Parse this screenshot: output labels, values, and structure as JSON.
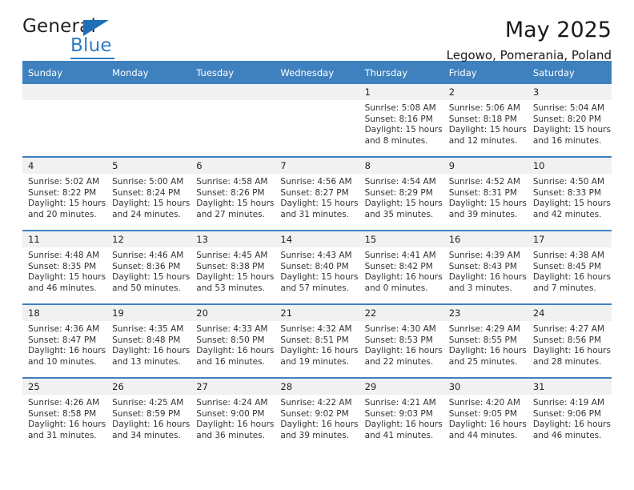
{
  "logo": {
    "word_top": "General",
    "word_bottom": "Blue"
  },
  "header": {
    "title": "May 2025",
    "subtitle": "Legowo, Pomerania, Poland"
  },
  "weekday_headers": [
    "Sunday",
    "Monday",
    "Tuesday",
    "Wednesday",
    "Thursday",
    "Friday",
    "Saturday"
  ],
  "colors": {
    "header_blue": "#3f81bf",
    "logo_blue": "#2b7cc4",
    "daynum_band": "#f1f1f1",
    "text": "#222222"
  },
  "weeks": [
    [
      {
        "day": "",
        "lines": []
      },
      {
        "day": "",
        "lines": []
      },
      {
        "day": "",
        "lines": []
      },
      {
        "day": "",
        "lines": []
      },
      {
        "day": "1",
        "lines": [
          "Sunrise: 5:08 AM",
          "Sunset: 8:16 PM",
          "Daylight: 15 hours",
          "and 8 minutes."
        ]
      },
      {
        "day": "2",
        "lines": [
          "Sunrise: 5:06 AM",
          "Sunset: 8:18 PM",
          "Daylight: 15 hours",
          "and 12 minutes."
        ]
      },
      {
        "day": "3",
        "lines": [
          "Sunrise: 5:04 AM",
          "Sunset: 8:20 PM",
          "Daylight: 15 hours",
          "and 16 minutes."
        ]
      }
    ],
    [
      {
        "day": "4",
        "lines": [
          "Sunrise: 5:02 AM",
          "Sunset: 8:22 PM",
          "Daylight: 15 hours",
          "and 20 minutes."
        ]
      },
      {
        "day": "5",
        "lines": [
          "Sunrise: 5:00 AM",
          "Sunset: 8:24 PM",
          "Daylight: 15 hours",
          "and 24 minutes."
        ]
      },
      {
        "day": "6",
        "lines": [
          "Sunrise: 4:58 AM",
          "Sunset: 8:26 PM",
          "Daylight: 15 hours",
          "and 27 minutes."
        ]
      },
      {
        "day": "7",
        "lines": [
          "Sunrise: 4:56 AM",
          "Sunset: 8:27 PM",
          "Daylight: 15 hours",
          "and 31 minutes."
        ]
      },
      {
        "day": "8",
        "lines": [
          "Sunrise: 4:54 AM",
          "Sunset: 8:29 PM",
          "Daylight: 15 hours",
          "and 35 minutes."
        ]
      },
      {
        "day": "9",
        "lines": [
          "Sunrise: 4:52 AM",
          "Sunset: 8:31 PM",
          "Daylight: 15 hours",
          "and 39 minutes."
        ]
      },
      {
        "day": "10",
        "lines": [
          "Sunrise: 4:50 AM",
          "Sunset: 8:33 PM",
          "Daylight: 15 hours",
          "and 42 minutes."
        ]
      }
    ],
    [
      {
        "day": "11",
        "lines": [
          "Sunrise: 4:48 AM",
          "Sunset: 8:35 PM",
          "Daylight: 15 hours",
          "and 46 minutes."
        ]
      },
      {
        "day": "12",
        "lines": [
          "Sunrise: 4:46 AM",
          "Sunset: 8:36 PM",
          "Daylight: 15 hours",
          "and 50 minutes."
        ]
      },
      {
        "day": "13",
        "lines": [
          "Sunrise: 4:45 AM",
          "Sunset: 8:38 PM",
          "Daylight: 15 hours",
          "and 53 minutes."
        ]
      },
      {
        "day": "14",
        "lines": [
          "Sunrise: 4:43 AM",
          "Sunset: 8:40 PM",
          "Daylight: 15 hours",
          "and 57 minutes."
        ]
      },
      {
        "day": "15",
        "lines": [
          "Sunrise: 4:41 AM",
          "Sunset: 8:42 PM",
          "Daylight: 16 hours",
          "and 0 minutes."
        ]
      },
      {
        "day": "16",
        "lines": [
          "Sunrise: 4:39 AM",
          "Sunset: 8:43 PM",
          "Daylight: 16 hours",
          "and 3 minutes."
        ]
      },
      {
        "day": "17",
        "lines": [
          "Sunrise: 4:38 AM",
          "Sunset: 8:45 PM",
          "Daylight: 16 hours",
          "and 7 minutes."
        ]
      }
    ],
    [
      {
        "day": "18",
        "lines": [
          "Sunrise: 4:36 AM",
          "Sunset: 8:47 PM",
          "Daylight: 16 hours",
          "and 10 minutes."
        ]
      },
      {
        "day": "19",
        "lines": [
          "Sunrise: 4:35 AM",
          "Sunset: 8:48 PM",
          "Daylight: 16 hours",
          "and 13 minutes."
        ]
      },
      {
        "day": "20",
        "lines": [
          "Sunrise: 4:33 AM",
          "Sunset: 8:50 PM",
          "Daylight: 16 hours",
          "and 16 minutes."
        ]
      },
      {
        "day": "21",
        "lines": [
          "Sunrise: 4:32 AM",
          "Sunset: 8:51 PM",
          "Daylight: 16 hours",
          "and 19 minutes."
        ]
      },
      {
        "day": "22",
        "lines": [
          "Sunrise: 4:30 AM",
          "Sunset: 8:53 PM",
          "Daylight: 16 hours",
          "and 22 minutes."
        ]
      },
      {
        "day": "23",
        "lines": [
          "Sunrise: 4:29 AM",
          "Sunset: 8:55 PM",
          "Daylight: 16 hours",
          "and 25 minutes."
        ]
      },
      {
        "day": "24",
        "lines": [
          "Sunrise: 4:27 AM",
          "Sunset: 8:56 PM",
          "Daylight: 16 hours",
          "and 28 minutes."
        ]
      }
    ],
    [
      {
        "day": "25",
        "lines": [
          "Sunrise: 4:26 AM",
          "Sunset: 8:58 PM",
          "Daylight: 16 hours",
          "and 31 minutes."
        ]
      },
      {
        "day": "26",
        "lines": [
          "Sunrise: 4:25 AM",
          "Sunset: 8:59 PM",
          "Daylight: 16 hours",
          "and 34 minutes."
        ]
      },
      {
        "day": "27",
        "lines": [
          "Sunrise: 4:24 AM",
          "Sunset: 9:00 PM",
          "Daylight: 16 hours",
          "and 36 minutes."
        ]
      },
      {
        "day": "28",
        "lines": [
          "Sunrise: 4:22 AM",
          "Sunset: 9:02 PM",
          "Daylight: 16 hours",
          "and 39 minutes."
        ]
      },
      {
        "day": "29",
        "lines": [
          "Sunrise: 4:21 AM",
          "Sunset: 9:03 PM",
          "Daylight: 16 hours",
          "and 41 minutes."
        ]
      },
      {
        "day": "30",
        "lines": [
          "Sunrise: 4:20 AM",
          "Sunset: 9:05 PM",
          "Daylight: 16 hours",
          "and 44 minutes."
        ]
      },
      {
        "day": "31",
        "lines": [
          "Sunrise: 4:19 AM",
          "Sunset: 9:06 PM",
          "Daylight: 16 hours",
          "and 46 minutes."
        ]
      }
    ]
  ]
}
